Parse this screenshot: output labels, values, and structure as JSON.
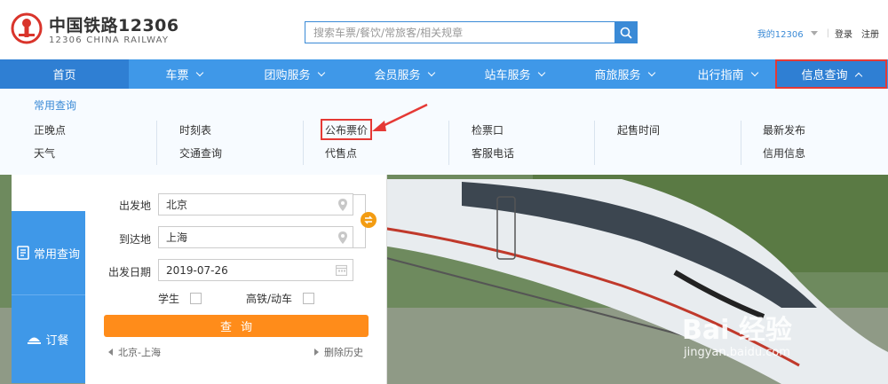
{
  "header": {
    "logo_cn": "中国铁路12306",
    "logo_en": "12306 CHINA RAILWAY",
    "search_placeholder": "搜索车票/餐饮/常旅客/相关规章",
    "my12306": "我的12306",
    "login": "登录",
    "register": "注册"
  },
  "nav": {
    "items": [
      {
        "label": "首页",
        "dropdown": false
      },
      {
        "label": "车票",
        "dropdown": true
      },
      {
        "label": "团购服务",
        "dropdown": true
      },
      {
        "label": "会员服务",
        "dropdown": true
      },
      {
        "label": "站车服务",
        "dropdown": true
      },
      {
        "label": "商旅服务",
        "dropdown": true
      },
      {
        "label": "出行指南",
        "dropdown": true
      },
      {
        "label": "信息查询",
        "dropdown": true,
        "expanded": true
      }
    ]
  },
  "dropdown": {
    "heading": "常用查询",
    "columns": [
      [
        "正晚点",
        "天气"
      ],
      [
        "时刻表",
        "交通查询"
      ],
      [
        "公布票价",
        "代售点"
      ],
      [
        "检票口",
        "客服电话"
      ],
      [
        "起售时间"
      ],
      [
        "最新发布",
        "信用信息"
      ]
    ]
  },
  "sidebar": {
    "tab_common": "常用查询",
    "tab_order": "订餐"
  },
  "form": {
    "from_label": "出发地",
    "from_value": "北京",
    "to_label": "到达地",
    "to_value": "上海",
    "date_label": "出发日期",
    "date_value": "2019-07-26",
    "student_label": "学生",
    "highspeed_label": "高铁/动车",
    "query_button": "查询",
    "history_item": "北京-上海",
    "history_clear": "删除历史"
  },
  "watermark": {
    "logo": "Bai  经验",
    "url": "jingyan.baidu.com"
  },
  "colors": {
    "nav_blue": "#3f98e8",
    "nav_active": "#2f7fd3",
    "link_blue": "#3a8ad6",
    "query_orange": "#ff8c1a",
    "highlight_red": "#e53935"
  }
}
